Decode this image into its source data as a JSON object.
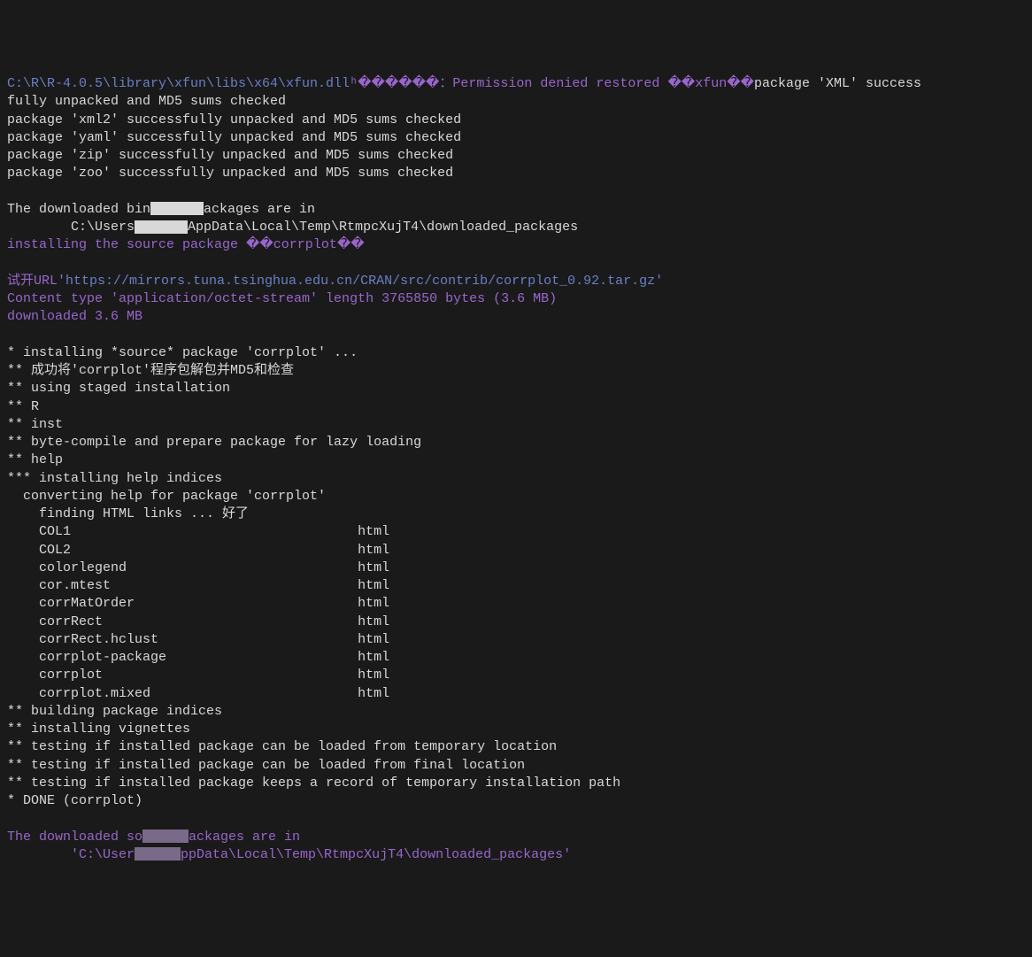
{
  "line1": {
    "path": "C:\\R\\R-4.0.5\\library\\xfun\\libs\\x64\\xfun.dll",
    "glyph1": "ʰ������",
    "colon": "：",
    "perm": "Permission denied restored ",
    "xfun": "��xfun��",
    "xml": "package 'XML' success"
  },
  "checked": {
    "continue": "fully unpacked and MD5 sums checked",
    "xml2": "package 'xml2' successfully unpacked and MD5 sums checked",
    "yaml": "package 'yaml' successfully unpacked and MD5 sums checked",
    "zip": "package 'zip' successfully unpacked and MD5 sums checked",
    "zoo": "package 'zoo' successfully unpacked and MD5 sums checked"
  },
  "binary": {
    "msg1": "The downloaded bin",
    "msg2": "ackages are in",
    "path1": "        C:\\Users",
    "path2": "AppData\\Local\\Temp\\RtmpcXujT4\\downloaded_packages",
    "installing": "installing the source package ��corrplot��"
  },
  "download": {
    "tryurl": "试开URL",
    "url": "'https://mirrors.tuna.tsinghua.edu.cn/CRAN/src/contrib/corrplot_0.92.tar.gz'",
    "content": "Content type 'application/octet-stream' length 3765850 bytes (3.6 MB)",
    "downloaded": "downloaded 3.6 MB"
  },
  "install": {
    "l1": "* installing *source* package 'corrplot' ...",
    "l2": "** 成功将'corrplot'程序包解包并MD5和检查",
    "l3": "** using staged installation",
    "l4": "** R",
    "l5": "** inst",
    "l6": "** byte-compile and prepare package for lazy loading",
    "l7": "** help",
    "l8": "*** installing help indices",
    "l9": "  converting help for package 'corrplot'",
    "l10": "    finding HTML links ... 好了"
  },
  "html_items": {
    "i1": "    COL1                                    html",
    "i2": "    COL2                                    html",
    "i3": "    colorlegend                             html",
    "i4": "    cor.mtest                               html",
    "i5": "    corrMatOrder                            html",
    "i6": "    corrRect                                html",
    "i7": "    corrRect.hclust                         html",
    "i8": "    corrplot-package                        html",
    "i9": "    corrplot                                html",
    "i10": "    corrplot.mixed                          html"
  },
  "finish": {
    "l1": "** building package indices",
    "l2": "** installing vignettes",
    "l3": "** testing if installed package can be loaded from temporary location",
    "l4": "** testing if installed package can be loaded from final location",
    "l5": "** testing if installed package keeps a record of temporary installation path",
    "l6": "* DONE (corrplot)"
  },
  "source_path": {
    "msg1": "The downloaded so",
    "msg2": "ackages are in",
    "path1": "        'C:\\User",
    "path2": "ppData\\Local\\Temp\\RtmpcXujT4\\downloaded_packages'"
  }
}
